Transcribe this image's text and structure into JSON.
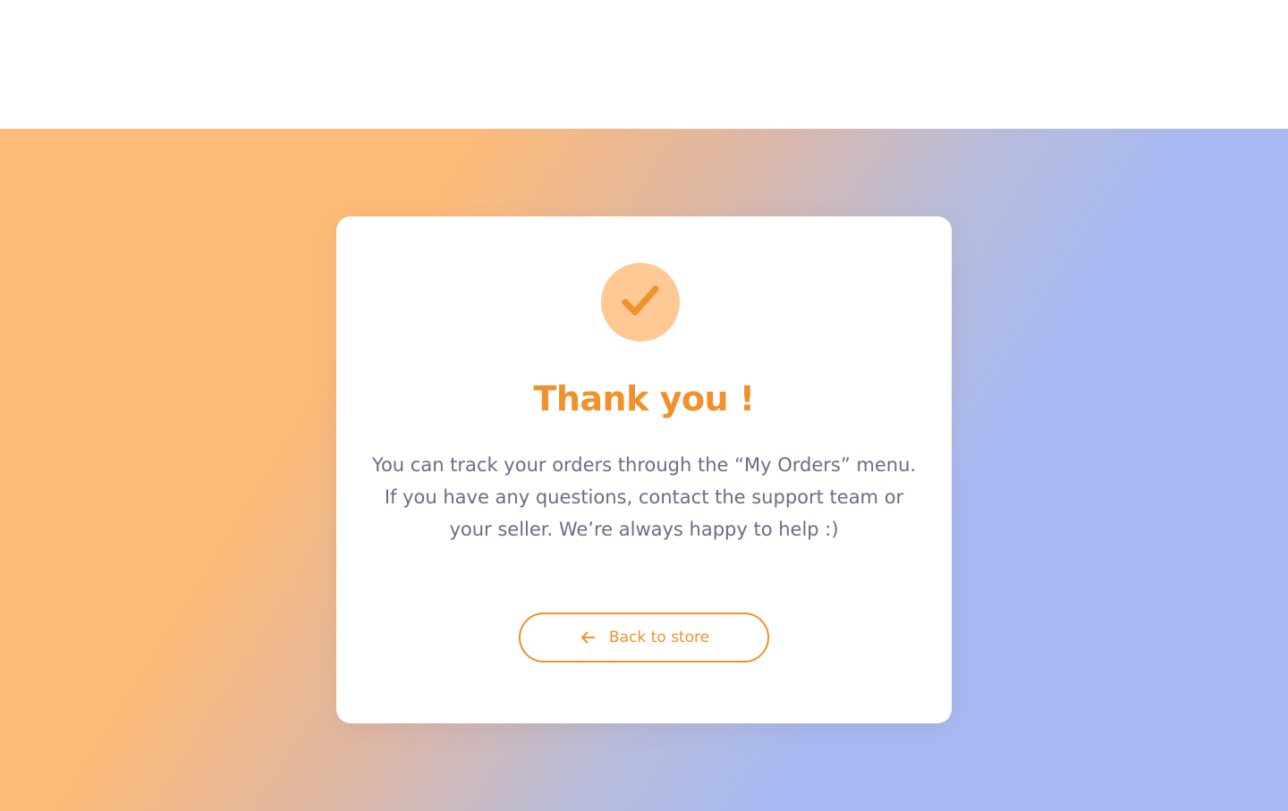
{
  "colors": {
    "accent": "#f0912c",
    "accent_light": "#fec994",
    "text_muted": "#6b6d85",
    "gradient_start": "#fdba78",
    "gradient_end": "#a7baf3"
  },
  "confirmation": {
    "icon": "check-icon",
    "title": "Thank you !",
    "message": "You can track your orders through the “My Orders” menu. If you have any questions, contact the support team or your seller. We’re always happy to help :)",
    "back_button": {
      "icon": "arrow-left-icon",
      "label": "Back to store"
    }
  }
}
